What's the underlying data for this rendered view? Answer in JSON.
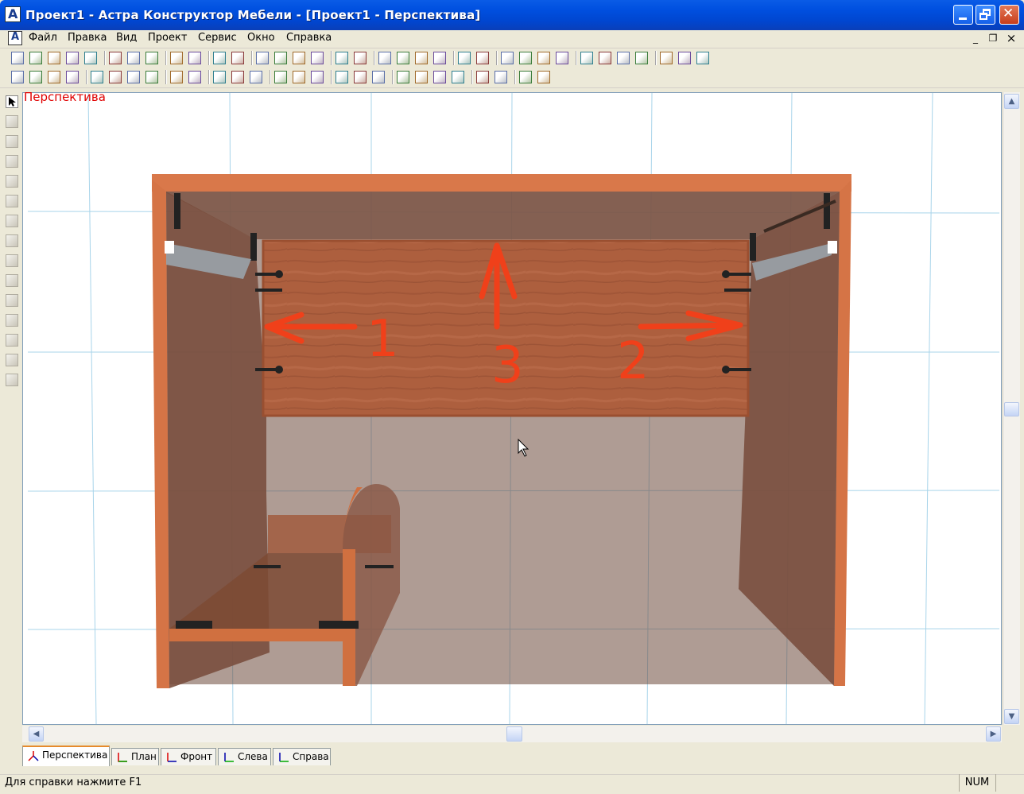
{
  "window": {
    "title": "Проект1 - Астра Конструктор Мебели - [Проект1 - Перспектива]",
    "app_icon_letter": "A"
  },
  "menu": {
    "items": [
      "Файл",
      "Правка",
      "Вид",
      "Проект",
      "Сервис",
      "Окно",
      "Справка"
    ],
    "doc_icon_letter": "A"
  },
  "view": {
    "label": "Перспектива",
    "label_color": "#e00000",
    "annotations": [
      "1",
      "2",
      "3"
    ],
    "annotation_color": "#f0401a",
    "panel_color": "#b0603c",
    "grid_color": "#a8d4ea"
  },
  "tabs": [
    {
      "label": "Перспектива",
      "active": true
    },
    {
      "label": "План",
      "active": false
    },
    {
      "label": "Фронт",
      "active": false
    },
    {
      "label": "Слева",
      "active": false
    },
    {
      "label": "Справа",
      "active": false
    }
  ],
  "status": {
    "help_text": "Для справки нажмите F1",
    "num_indicator": "NUM"
  },
  "scroll": {
    "up_glyph": "▲",
    "down_glyph": "▼",
    "left_glyph": "◀",
    "right_glyph": "▶"
  },
  "caption_buttons": {
    "minimize": "_",
    "maximize": "□",
    "close": "✕"
  },
  "mdi_buttons": {
    "minimize": "_",
    "restore": "❐",
    "close": "×"
  },
  "toolbar_icons_1": [
    "new-file-icon",
    "open-folder-icon",
    "save-icon",
    "print-icon",
    "print-preview-icon",
    "cut-icon",
    "copy-icon",
    "paste-icon",
    "undo-icon",
    "redo-icon",
    "select-all-icon",
    "deselect-icon",
    "pin-icon",
    "arrows-icon",
    "tree-icon",
    "sum-icon",
    "layer-icon",
    "frame-icon",
    "zoom-in-icon",
    "zoom-out-icon",
    "zoom-fit-icon",
    "rotate-view-icon",
    "target-icon",
    "close-view-icon",
    "wire-box-icon",
    "solid-box-icon",
    "box-yellow-icon",
    "box-blue-icon",
    "fill-icon",
    "object-icon",
    "dimension-icon",
    "axis-icon",
    "hatch-icon",
    "hand-icon",
    "eraser-icon"
  ],
  "toolbar_icons_2": [
    "cube-icon",
    "cylinder-icon",
    "cone-icon",
    "pyramid-icon",
    "align-top-icon",
    "align-bottom-icon",
    "align-left-icon",
    "align-right-icon",
    "distribute-h-icon",
    "distribute-v-icon",
    "grid-a-icon",
    "grid-b-icon",
    "grid-c-icon",
    "grid-d-icon",
    "grid-e-icon",
    "grid-f-icon",
    "grid-g-icon",
    "grid-h-icon",
    "grid-i-icon",
    "arrange-a-icon",
    "arrange-b-icon",
    "arrange-c-icon",
    "arrange-d-icon",
    "space-a-icon",
    "space-b-icon",
    "space-c-icon",
    "space-d-icon"
  ],
  "left_tools": [
    "pointer-icon",
    "pen-icon",
    "new-panel-icon",
    "rectangle-icon",
    "edit-icon",
    "delete-icon",
    "move-icon",
    "stretch-h-icon",
    "stretch-v-icon",
    "rotate-left-icon",
    "rotate-icon",
    "rotate-right-icon",
    "scale-icon",
    "mirror-icon",
    "properties-icon"
  ]
}
